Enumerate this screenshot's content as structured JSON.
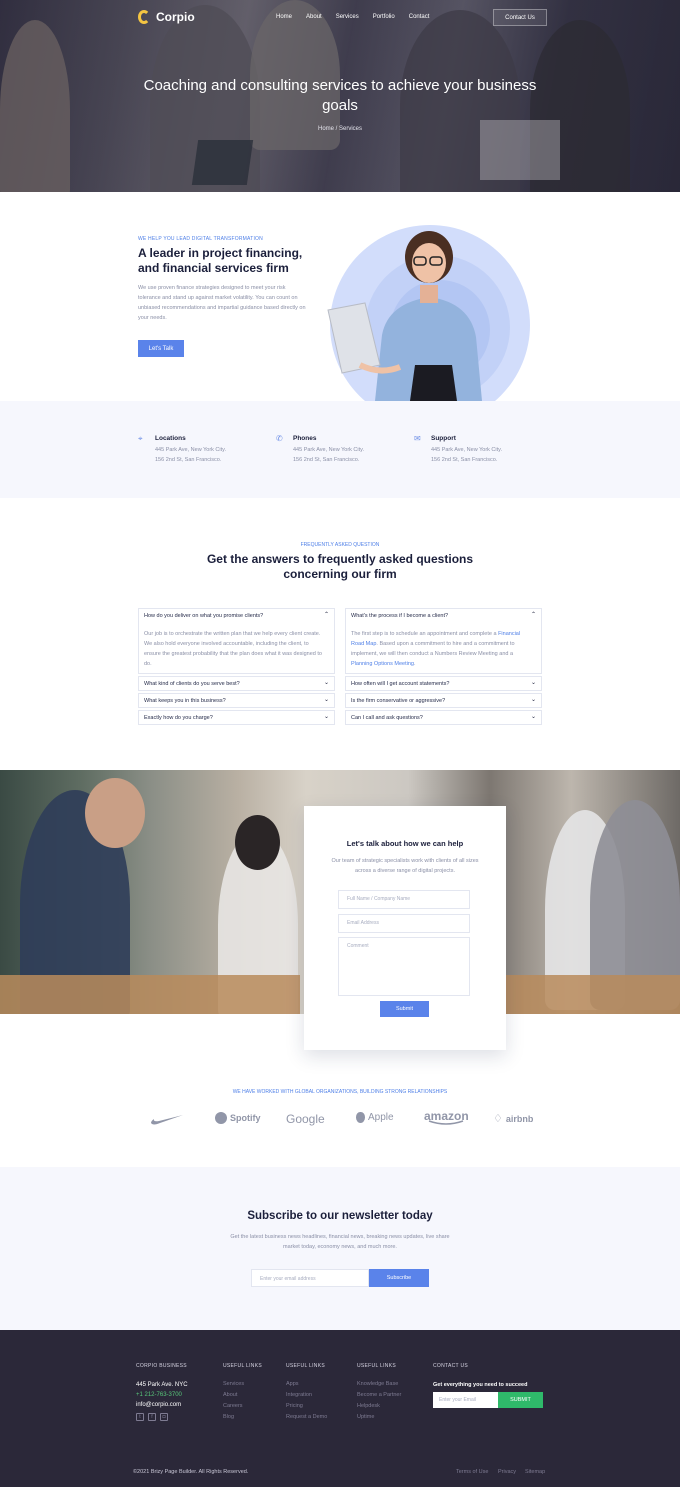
{
  "header": {
    "brand": "Corpio",
    "nav": [
      "Home",
      "About",
      "Services",
      "Portfolio",
      "Contact"
    ],
    "cta": "Contact Us",
    "title": "Coaching and consulting services to achieve your business goals",
    "breadcrumb": "Home / Services"
  },
  "intro": {
    "eyebrow": "WE HELP YOU LEAD DIGITAL TRANSFORMATION",
    "title": "A leader in project financing, and financial services firm",
    "text": "We use proven finance strategies designed to meet your risk tolerance and stand up against market volatility. You can count on unbiased recommendations and impartial guidance based directly on your needs.",
    "button": "Let's Talk"
  },
  "info": [
    {
      "icon": "location-pin-icon",
      "title": "Locations",
      "line1": "445 Park Ave, New York City.",
      "line2": "156 2nd St, San Francisco."
    },
    {
      "icon": "phone-icon",
      "title": "Phones",
      "line1": "445 Park Ave, New York City.",
      "line2": "156 2nd St, San Francisco."
    },
    {
      "icon": "envelope-icon",
      "title": "Support",
      "line1": "445 Park Ave, New York City.",
      "line2": "156 2nd St, San Francisco."
    }
  ],
  "faq": {
    "eyebrow": "FREQUENTLY ASKED QUESTION",
    "title": "Get the answers to frequently asked questions concerning our firm",
    "left": [
      {
        "q": "How do you deliver on what you promise clients?",
        "open": true,
        "a": "Our job is to orchestrate the written plan that we help every client create. We also hold everyone involved accountable, including the client, to ensure the greatest probability that the plan does what it was designed to do."
      },
      {
        "q": "What kind of clients do you serve best?",
        "open": false
      },
      {
        "q": "What keeps you in this business?",
        "open": false
      },
      {
        "q": "Exactly how do you charge?",
        "open": false
      }
    ],
    "right": [
      {
        "q": "What's the process if I become a client?",
        "open": true,
        "a_part1": "The first step is to schedule an appointment and complete a ",
        "a_link1": "Financial Road Map",
        "a_part2": ". Based upon a commitment to hire and a commitment to implement, we will then conduct a Numbers Review Meeting and a ",
        "a_link2": "Planning Options Meeting",
        "a_part3": "."
      },
      {
        "q": "How often will I get account statements?",
        "open": false
      },
      {
        "q": "Is the firm conservative or aggressive?",
        "open": false
      },
      {
        "q": "Can I call and ask questions?",
        "open": false
      }
    ]
  },
  "contact_form": {
    "title": "Let's talk about how we can help",
    "text": "Our team of strategic specialists work with clients of all sizes across a diverse range of digital projects.",
    "name_placeholder": "Full Name / Company Name",
    "email_placeholder": "Email Address",
    "comment_placeholder": "Comment",
    "submit": "Submit"
  },
  "clients": {
    "eyebrow": "WE HAVE WORKED WITH GLOBAL ORGANIZATIONS, BUILDING STRONG RELATIONSHIPS",
    "logos": [
      "nike",
      "Spotify",
      "Google",
      "Apple",
      "amazon",
      "airbnb"
    ]
  },
  "newsletter": {
    "title": "Subscribe to our newsletter today",
    "text": "Get the latest business news headlines, financial news, breaking news updates, live share market today, economy news, and much more.",
    "placeholder": "Enter your email address",
    "button": "Subscribe"
  },
  "footer": {
    "col1": {
      "heading": "CORPIO BUSINESS",
      "address": "445 Park Ave. NYC",
      "phone": "+1 212-763-3700",
      "email": "info@corpio.com"
    },
    "col2": {
      "heading": "USEFUL LINKS",
      "links": [
        "Services",
        "About",
        "Careers",
        "Blog"
      ]
    },
    "col3": {
      "heading": "USEFUL LINKS",
      "links": [
        "Apps",
        "Integration",
        "Pricing",
        "Request a Demo"
      ]
    },
    "col4": {
      "heading": "USEFUL LINKS",
      "links": [
        "Knowledge Base",
        "Become a Partner",
        "Helpdesk",
        "Uptime"
      ]
    },
    "col5": {
      "heading": "CONTACT US",
      "text": "Get everything you need to succeed",
      "placeholder": "Enter your Email",
      "button": "SUBMIT"
    },
    "copyright": "©2021 Brizy Page Builder. All Rights Reserved.",
    "bottom_links": [
      "Terms of Use",
      "Privacy",
      "Sitemap"
    ]
  },
  "colors": {
    "accent": "#5a83ea",
    "footer_bg": "#2b2839",
    "success": "#2fb96a"
  }
}
